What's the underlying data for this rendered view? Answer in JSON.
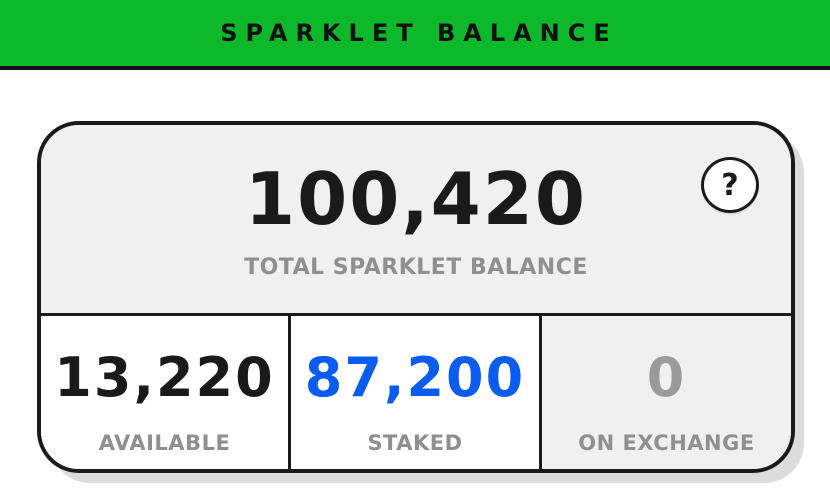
{
  "header": {
    "title": "SPARKLET BALANCE",
    "color": "#0db82b"
  },
  "balance": {
    "total_value": "100,420",
    "total_label": "TOTAL SPARKLET BALANCE",
    "help_icon": "question-mark-icon",
    "help_symbol": "?"
  },
  "stats": [
    {
      "value": "13,220",
      "label": "AVAILABLE",
      "color": "#1a1a1a"
    },
    {
      "value": "87,200",
      "label": "STAKED",
      "color": "#0a5cf0"
    },
    {
      "value": "0",
      "label": "ON EXCHANGE",
      "color": "#9a9a9a"
    }
  ]
}
